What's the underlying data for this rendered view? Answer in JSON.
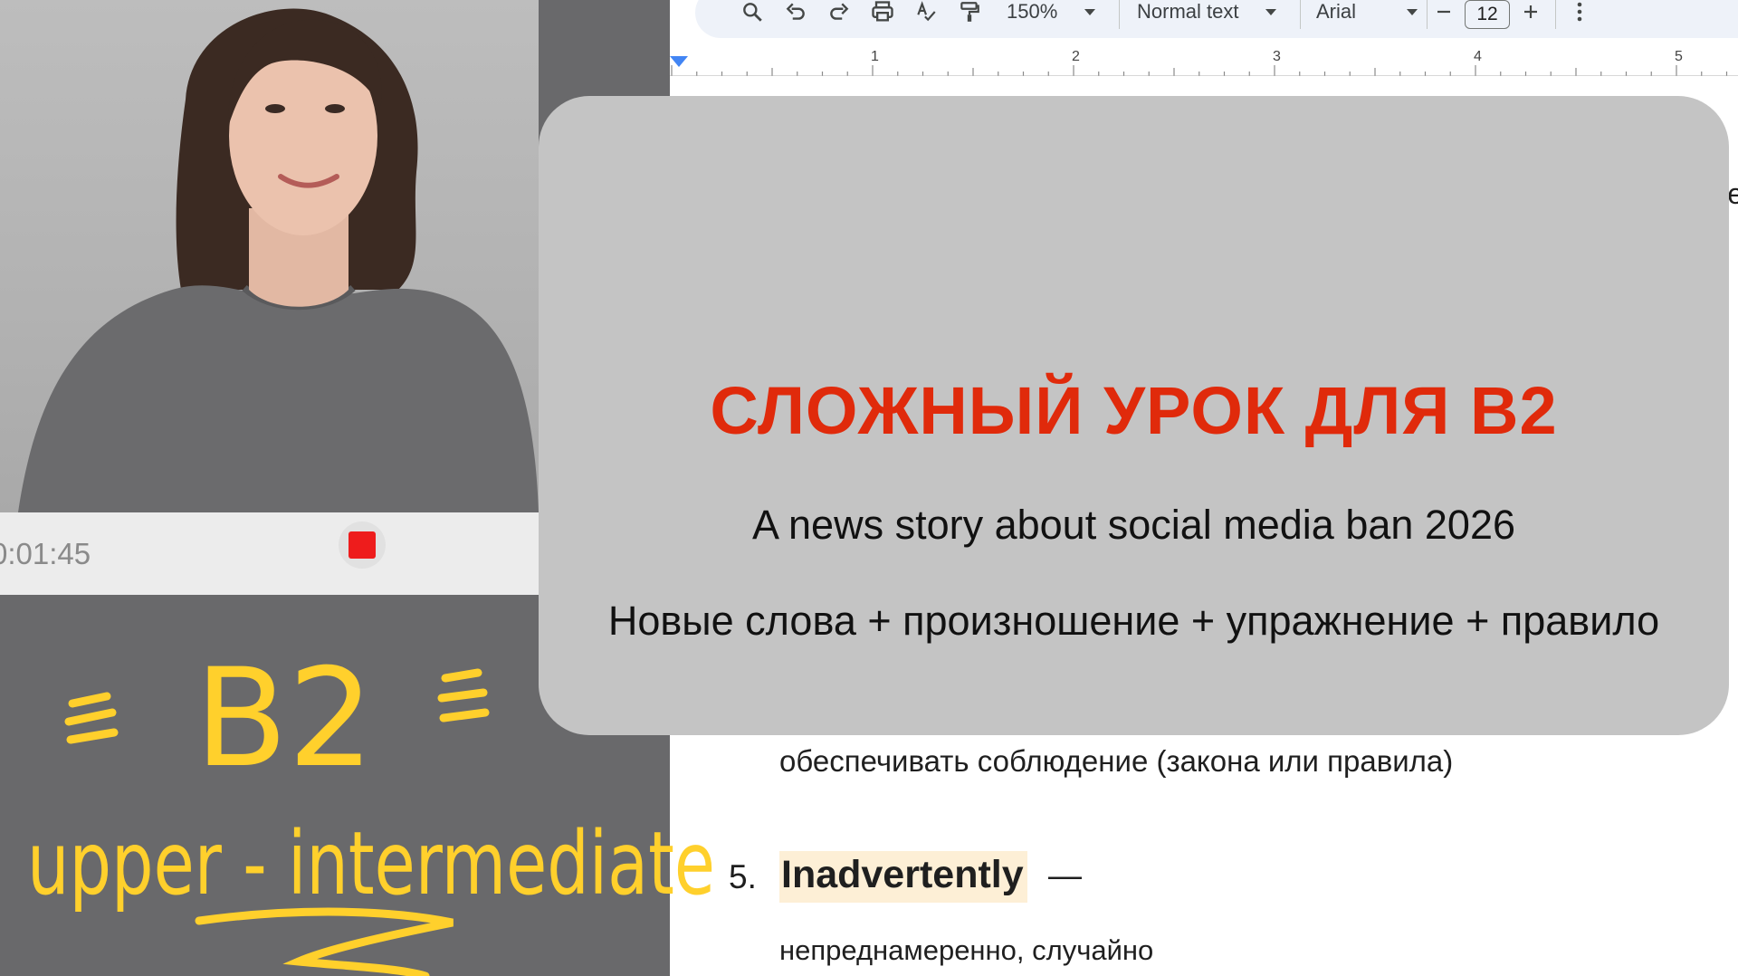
{
  "toolbar": {
    "zoom": "150%",
    "style": "Normal text",
    "font": "Arial",
    "font_size": "12",
    "icons": [
      "search-icon",
      "undo-icon",
      "redo-icon",
      "print-icon",
      "spellcheck-icon",
      "paint-format-icon",
      "more-vert-icon"
    ]
  },
  "ruler": {
    "numbers": [
      "1",
      "2",
      "3",
      "4",
      "5"
    ]
  },
  "document": {
    "item4_translation": "обеспечивать соблюдение (закона или правила)",
    "item5_number": "5.",
    "item5_word": "Inadvertently",
    "item5_dash": "—",
    "item5_translation": "непреднамеренно, случайно",
    "edge_letter": "e"
  },
  "recorder": {
    "timer": "0:01:45"
  },
  "doodle": {
    "level": "B2",
    "level_name": "upper - intermediate",
    "color": "#ffd02c"
  },
  "card": {
    "title": "СЛОЖНЫЙ УРОК ДЛЯ B2",
    "subtitle": "A news story about social media ban 2026",
    "description": "Новые слова + произношение + упражнение + правило"
  },
  "colors": {
    "title_red": "#e02a0b",
    "card_bg": "#c4c4c4",
    "highlight": "#fdefd6",
    "stop_red": "#ee1c1c"
  }
}
